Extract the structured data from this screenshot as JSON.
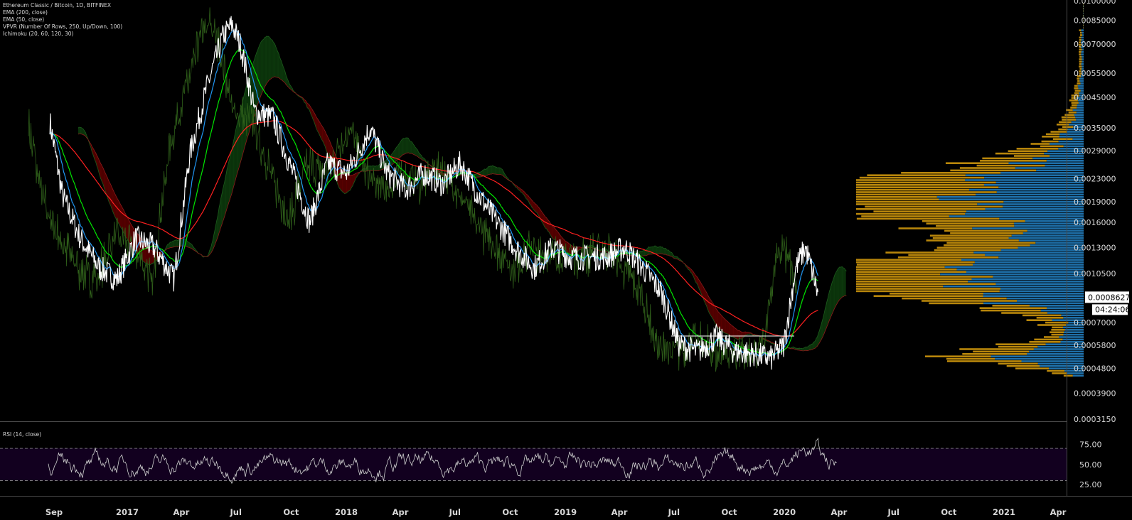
{
  "legend": {
    "title": "Ethereum Classic / Bitcoin, 1D, BITFINEX",
    "ema200": "EMA (200, close)",
    "ema50": "EMA (50, close)",
    "vpvr": "VPVR (Number Of Rows, 250, Up/Down, 100)",
    "ichimoku": "Ichimoku (20, 60, 120, 30)"
  },
  "rsi_title": "RSI (14, close)",
  "current_price": "0.0008627",
  "countdown": "04:24:06",
  "colors": {
    "price": "#ffffff",
    "ema_fast": "#2196f3",
    "ema_mid": "#00e600",
    "ema_slow": "#ff2020",
    "cloud_bear": "#5a0000",
    "cloud_bull": "#0d3a0d",
    "lagging": "#2f5f1a",
    "vp_up": "#1e6fa8",
    "vp_down": "#b8860b",
    "rsi": "#cfcfcf",
    "rsi_band": "#12001f"
  },
  "chart_data": {
    "type": "line",
    "title": "Ethereum Classic / Bitcoin, 1D, BITFINEX",
    "y_axis_ticks": [
      "0.0100000",
      "0.0085000",
      "0.0070000",
      "0.0055000",
      "0.0045000",
      "0.0035000",
      "0.0029000",
      "0.0023000",
      "0.0019000",
      "0.0016000",
      "0.0013000",
      "0.0010500",
      "0.0007000",
      "0.0005800",
      "0.0004800",
      "0.0003900",
      "0.0003150"
    ],
    "y_axis_values": [
      0.01,
      0.0085,
      0.007,
      0.0055,
      0.0045,
      0.0035,
      0.0029,
      0.0023,
      0.0019,
      0.0016,
      0.0013,
      0.00105,
      0.0007,
      0.00058,
      0.00048,
      0.00039,
      0.000315
    ],
    "y_scale": "log",
    "x_axis_ticks": [
      "Sep",
      "2017",
      "Apr",
      "Jul",
      "Oct",
      "2018",
      "Apr",
      "Jul",
      "Oct",
      "2019",
      "Apr",
      "Jul",
      "Oct",
      "2020",
      "Apr",
      "Jul",
      "Oct",
      "2021",
      "Apr"
    ],
    "x_axis_dates": [
      "2016-09-01",
      "2017-01-01",
      "2017-04-01",
      "2017-07-01",
      "2017-10-01",
      "2018-01-01",
      "2018-04-01",
      "2018-07-01",
      "2018-10-01",
      "2019-01-01",
      "2019-04-01",
      "2019-07-01",
      "2019-10-01",
      "2020-01-01",
      "2020-04-01",
      "2020-07-01",
      "2020-10-01",
      "2021-01-01",
      "2021-04-01"
    ],
    "series": [
      {
        "x": [
          "2016-08-25",
          "2016-09-15",
          "2016-10-15",
          "2016-11-15",
          "2016-12-15",
          "2017-01-15",
          "2017-02-15",
          "2017-03-20",
          "2017-04-15",
          "2017-05-15",
          "2017-06-10",
          "2017-06-25",
          "2017-07-10",
          "2017-08-01",
          "2017-09-01",
          "2017-10-01",
          "2017-11-01",
          "2017-12-01",
          "2018-01-01",
          "2018-01-15",
          "2018-02-10",
          "2018-03-10",
          "2018-04-10",
          "2018-05-10",
          "2018-06-10",
          "2018-07-10",
          "2018-08-10",
          "2018-09-10",
          "2018-10-10",
          "2018-11-10",
          "2018-12-10",
          "2019-01-10",
          "2019-02-10",
          "2019-03-10",
          "2019-04-10",
          "2019-05-10",
          "2019-06-10",
          "2019-07-10",
          "2019-08-10",
          "2019-09-10",
          "2019-10-10",
          "2019-11-10",
          "2019-12-10",
          "2019-12-31",
          "2020-01-20",
          "2020-02-05",
          "2020-02-20",
          "2020-02-27"
        ],
        "y": [
          0.0037,
          0.002,
          0.0014,
          0.0011,
          0.001,
          0.0014,
          0.0013,
          0.001,
          0.0028,
          0.005,
          0.0075,
          0.0082,
          0.0068,
          0.004,
          0.0038,
          0.0025,
          0.0016,
          0.0026,
          0.0024,
          0.0027,
          0.0035,
          0.0024,
          0.0021,
          0.0024,
          0.0022,
          0.0026,
          0.002,
          0.0016,
          0.0013,
          0.0011,
          0.0013,
          0.0012,
          0.0012,
          0.0012,
          0.0013,
          0.0011,
          0.0009,
          0.00058,
          0.00055,
          0.00062,
          0.00055,
          0.00054,
          0.00052,
          0.00058,
          0.0011,
          0.0013,
          0.001,
          0.00086
        ]
      }
    ],
    "rsi": {
      "levels": [
        "75.00",
        "50.00",
        "25.00"
      ],
      "level_values": [
        75,
        50,
        25
      ],
      "upper_band": 70,
      "lower_band": 30
    }
  }
}
